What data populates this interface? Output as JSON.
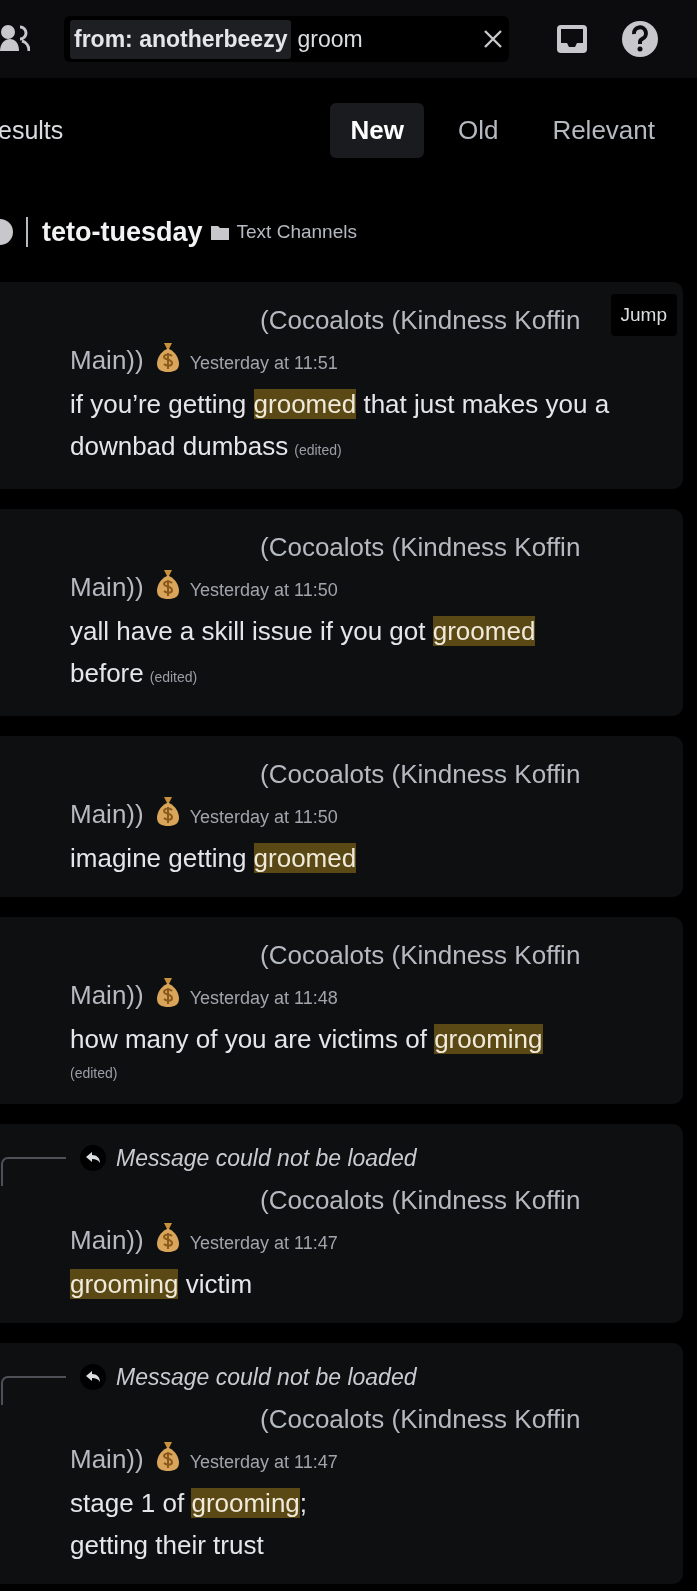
{
  "search": {
    "filter": "from: anotherbeezy",
    "query": "groom"
  },
  "results_label": "esults",
  "sort_tabs": [
    {
      "label": "New",
      "selected": true
    },
    {
      "label": "Old",
      "selected": false
    },
    {
      "label": "Relevant",
      "selected": false
    }
  ],
  "channel": {
    "name": "teto-tuesday",
    "category": "Text Channels"
  },
  "messages": [
    {
      "author_lines": [
        "(Cocoalots (Kindness Koffin",
        "Main))"
      ],
      "time": "Yesterday at 11:51",
      "jump": "Jump",
      "content": [
        {
          "text": "if you’re getting "
        },
        {
          "text": "groomed",
          "highlight": true
        },
        {
          "text": " that just makes you a downbad dumbass"
        }
      ],
      "edited": "(edited)"
    },
    {
      "author_lines": [
        "(Cocoalots (Kindness Koffin",
        "Main))"
      ],
      "time": "Yesterday at 11:50",
      "content": [
        {
          "text": "yall have a skill issue if you got "
        },
        {
          "text": "groomed",
          "highlight": true
        },
        {
          "text": " before"
        }
      ],
      "edited": "(edited)"
    },
    {
      "author_lines": [
        "(Cocoalots (Kindness Koffin",
        "Main))"
      ],
      "time": "Yesterday at 11:50",
      "content": [
        {
          "text": "imagine getting "
        },
        {
          "text": "groomed",
          "highlight": true
        }
      ]
    },
    {
      "author_lines": [
        "(Cocoalots (Kindness Koffin",
        "Main))"
      ],
      "time": "Yesterday at 11:48",
      "content": [
        {
          "text": "how many of you are victims of "
        },
        {
          "text": "grooming",
          "highlight": true
        }
      ],
      "edited": "(edited)",
      "edited_on_new_line": true
    },
    {
      "reply": "Message could not be loaded",
      "author_lines": [
        "(Cocoalots (Kindness Koffin",
        "Main))"
      ],
      "time": "Yesterday at 11:47",
      "content": [
        {
          "text": "grooming",
          "highlight": true
        },
        {
          "text": " victim"
        }
      ]
    },
    {
      "reply": "Message could not be loaded",
      "author_lines": [
        "(Cocoalots (Kindness Koffin",
        "Main))"
      ],
      "time": "Yesterday at 11:47",
      "content": [
        {
          "text": "stage 1 of "
        },
        {
          "text": "grooming",
          "highlight": true
        },
        {
          "text": ";\ngetting their trust"
        }
      ]
    }
  ]
}
